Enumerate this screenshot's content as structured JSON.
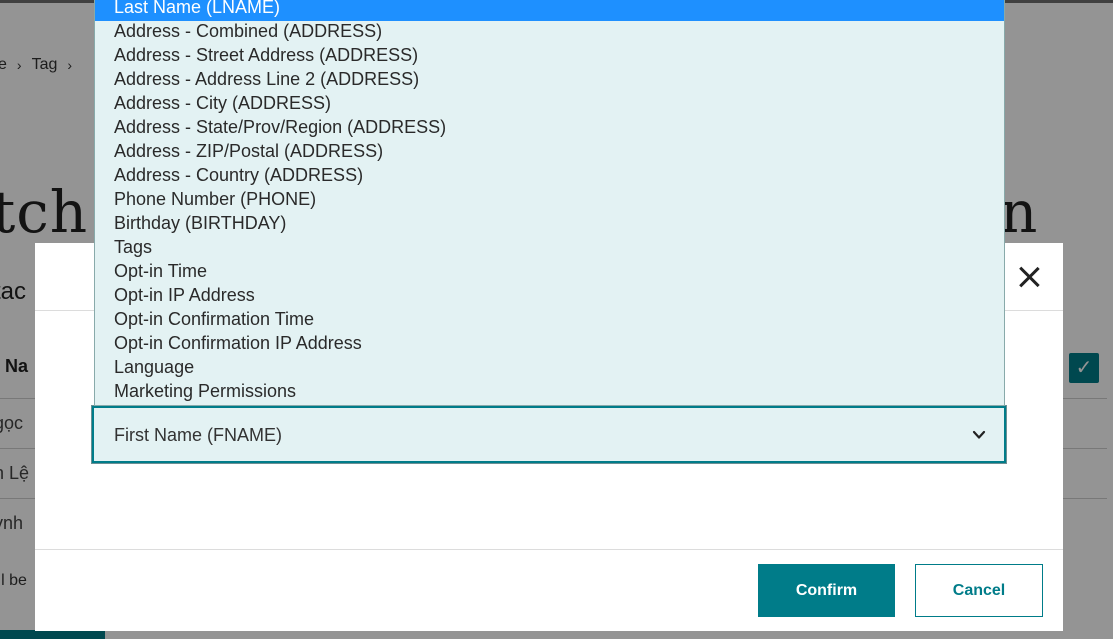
{
  "background": {
    "breadcrumb": [
      "e",
      "Tag"
    ],
    "heading_left": "tch",
    "heading_right": "n",
    "subheading": "tac",
    "column_header": "t Na",
    "rows": [
      "gọc",
      "n Lệ",
      "ỳnh"
    ],
    "note": "ill be"
  },
  "dropdown": {
    "options": [
      "Last Name (LNAME)",
      "Address - Combined (ADDRESS)",
      "Address - Street Address (ADDRESS)",
      "Address - Address Line 2 (ADDRESS)",
      "Address - City (ADDRESS)",
      "Address - State/Prov/Region (ADDRESS)",
      "Address - ZIP/Postal (ADDRESS)",
      "Address - Country (ADDRESS)",
      "Phone Number (PHONE)",
      "Birthday (BIRTHDAY)",
      "Tags",
      "Opt-in Time",
      "Opt-in IP Address",
      "Opt-in Confirmation Time",
      "Opt-in Confirmation IP Address",
      "Language",
      "Marketing Permissions"
    ],
    "highlighted_option": "Last Name (LNAME)"
  },
  "modal": {
    "select_value": "First Name (FNAME)",
    "confirm_label": "Confirm",
    "cancel_label": "Cancel"
  },
  "colors": {
    "accent": "#007c89",
    "dropdown_bg": "#e3f2f3",
    "highlight": "#1e90ff"
  },
  "icons": {
    "close": "close-icon",
    "chevron": "chevron-down-icon",
    "check": "checkmark-icon"
  }
}
